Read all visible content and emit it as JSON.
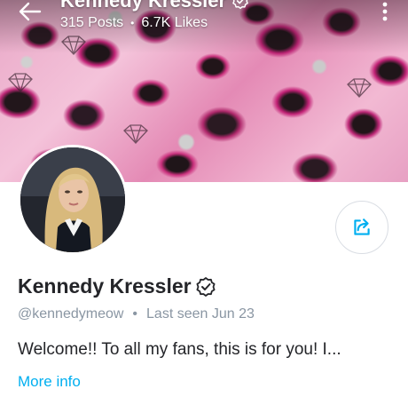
{
  "header": {
    "back_icon": "arrow-left-icon",
    "title": "Kennedy Kressler",
    "posts": "315 Posts",
    "separator": "•",
    "likes": "6.7K Likes",
    "more_icon": "vertical-dots-icon"
  },
  "profile": {
    "name": "Kennedy Kressler",
    "verified_icon": "verified-badge-icon",
    "handle": "@kennedymeow",
    "separator": "•",
    "last_seen": "Last seen Jun 23",
    "bio": "Welcome!! To all my fans, this is for you! I...",
    "more_info_label": "More info",
    "share_icon": "share-icon"
  },
  "colors": {
    "accent": "#00aff0",
    "muted_text": "#8a96a3",
    "text": "#242529",
    "banner_pink": "#e48ab5"
  }
}
